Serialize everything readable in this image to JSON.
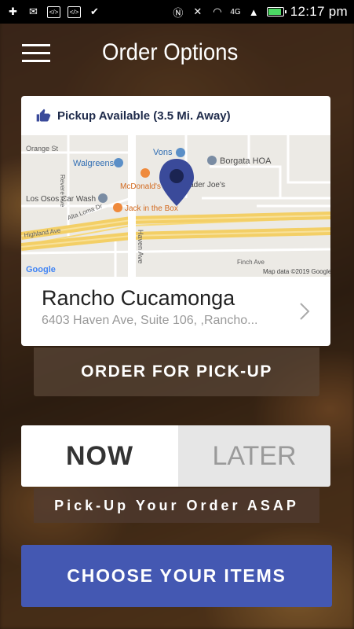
{
  "status_bar": {
    "time": "12:17 pm",
    "network": "4G",
    "icons": [
      "plus-icon",
      "mail-icon",
      "code-icon",
      "code-icon",
      "check-icon",
      "nfc-icon",
      "mute-icon",
      "wifi-icon",
      "signal-icon",
      "battery-icon"
    ]
  },
  "header": {
    "title": "Order Options",
    "menu_icon": "hamburger-menu-icon"
  },
  "location": {
    "pickup_text": "Pickup Available (3.5 Mi. Away)",
    "store_name": "Rancho Cucamonga",
    "store_address": "6403 Haven Ave, Suite 106, ,Rancho...",
    "map": {
      "labels": {
        "orange_st": "Orange St",
        "walgreens": "Walgreens",
        "vons": "Vons",
        "borgata": "Borgata HOA",
        "mcdonalds": "McDonald's",
        "trader_joes": "Trader Joe's",
        "los_osos": "Los Osos Car Wash",
        "jack": "Jack in the Box",
        "alta_loma": "Alta Loma Dr",
        "highland": "Highland Ave",
        "haven": "Haven Ave",
        "finch": "Finch Ave",
        "revere": "Revere Ave",
        "google": "Google",
        "copyright": "Map data ©2019 Google"
      }
    }
  },
  "pickup_button": "ORDER FOR PICK-UP",
  "time_toggle": {
    "now": "NOW",
    "later": "LATER"
  },
  "asap_label": "Pick-Up Your Order ASAP",
  "choose_button": "CHOOSE YOUR ITEMS",
  "colors": {
    "accent": "#4458b2",
    "pin": "#3a4a9a",
    "pickup_text": "#1e2a4a"
  }
}
